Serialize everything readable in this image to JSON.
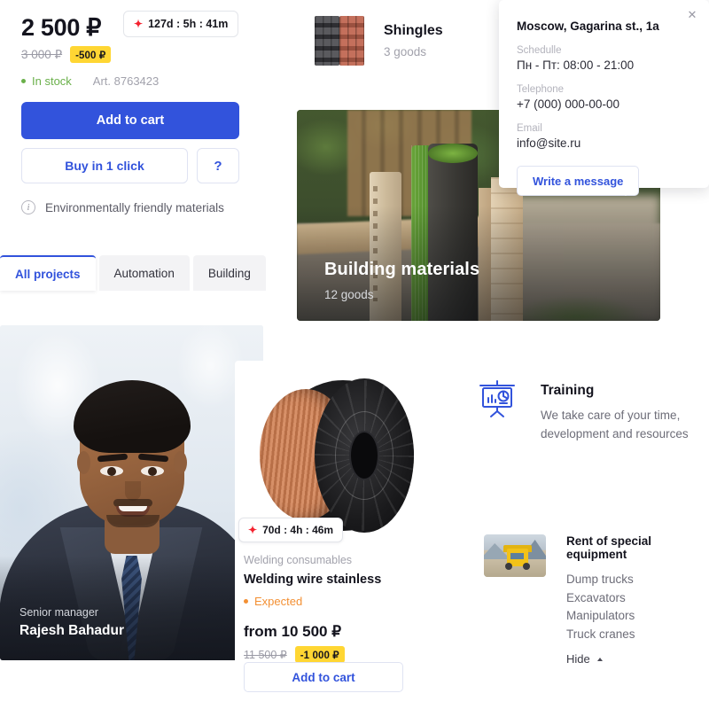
{
  "product": {
    "price": "2 500 ₽",
    "old_price": "3 000 ₽",
    "discount_badge": "-500 ₽",
    "timer": "127d : 5h : 41m",
    "timer_icon": "sparkle-icon",
    "stock_status": "In stock",
    "article": "Art. 8763423",
    "add_to_cart_label": "Add to cart",
    "buy_one_click_label": "Buy in 1 click",
    "help_label": "?",
    "eco_note": "Environmentally friendly materials",
    "info_icon": "info-circle-icon"
  },
  "tabs": [
    {
      "label": "All projects",
      "active": true
    },
    {
      "label": "Automation",
      "active": false
    },
    {
      "label": "Building",
      "active": false
    }
  ],
  "manager": {
    "role": "Senior manager",
    "name": "Rajesh Bahadur"
  },
  "shingles": {
    "title": "Shingles",
    "count": "3 goods",
    "image_name": "roof-shingles-stack-image"
  },
  "banner": {
    "title": "Building materials",
    "count": "12 goods",
    "image_name": "building-materials-photo"
  },
  "contact": {
    "address": "Moscow, Gagarina st., 1a",
    "schedule_label": "Schedulle",
    "schedule_value": "Пн - Пт: 08:00 - 21:00",
    "telephone_label": "Telephone",
    "telephone_value": "+7 (000) 000-00-00",
    "email_label": "Email",
    "email_value": "info@site.ru",
    "write_message_label": "Write a message",
    "close_icon": "close-icon"
  },
  "welding": {
    "timer": "70d : 4h : 46m",
    "timer_icon": "sparkle-icon",
    "category": "Welding consumables",
    "name": "Welding wire stainless",
    "status": "Expected",
    "price": "from 10 500 ₽",
    "old_price": "11 500 ₽",
    "discount_badge": "-1 000 ₽",
    "add_to_cart_label": "Add to cart",
    "image_name": "welding-wire-spool-image"
  },
  "training": {
    "title": "Training",
    "description": "We take care of your time, development and resources",
    "icon": "presentation-chart-icon"
  },
  "rent": {
    "title": "Rent of special equipment",
    "items": [
      "Dump trucks",
      "Excavators",
      "Manipulators",
      "Truck cranes"
    ],
    "hide_label": "Hide",
    "hide_icon": "caret-up-icon",
    "image_name": "dump-truck-photo"
  },
  "colors": {
    "accent_blue": "#3253dc",
    "badge_yellow": "#FFD633",
    "stock_green": "#6ab04a",
    "expected_orange": "#f39034",
    "spark_red": "#f4212e"
  }
}
